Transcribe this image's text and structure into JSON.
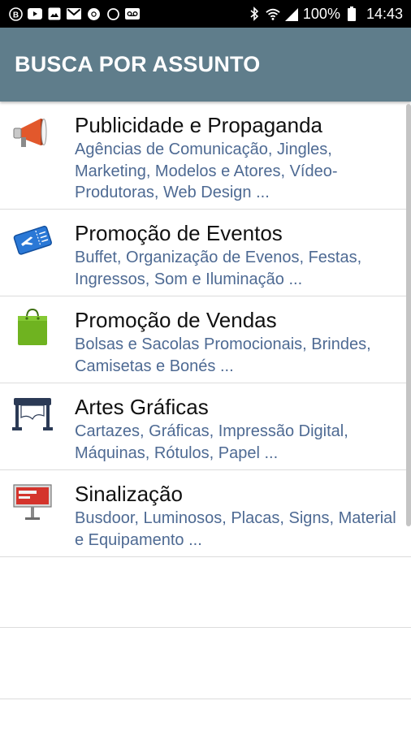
{
  "status_bar": {
    "left_icons": [
      "b-circle-icon",
      "youtube-icon",
      "gallery-icon",
      "gmail-icon",
      "chrome-icon",
      "circle-icon",
      "voicemail-icon"
    ],
    "battery": "100%",
    "time": "14:43"
  },
  "appbar": {
    "title": "BUSCA POR ASSUNTO"
  },
  "categories": [
    {
      "icon": "megaphone-icon",
      "title": "Publicidade e Propaganda",
      "desc": "Agências de Comunicação, Jingles, Marketing, Modelos e Atores, Vídeo-Produtoras, Web Design ..."
    },
    {
      "icon": "ticket-icon",
      "title": "Promoção de Eventos",
      "desc": "Buffet, Organização de Evenos, Festas, Ingressos, Som e Iluminação ..."
    },
    {
      "icon": "shopping-bag-icon",
      "title": "Promoção de Vendas",
      "desc": "Bolsas e Sacolas Promocionais, Brindes, Camisetas e Bonés ..."
    },
    {
      "icon": "printer-icon",
      "title": "Artes Gráficas",
      "desc": "Cartazes, Gráficas, Impressão Digital, Máquinas, Rótulos, Papel ..."
    },
    {
      "icon": "billboard-icon",
      "title": "Sinalização",
      "desc": "Busdoor, Luminosos, Placas, Signs, Material e Equipamento ..."
    }
  ],
  "colors": {
    "appbar": "#5f7d8b",
    "desc_text": "#4e6a93",
    "status_bar": "#000000"
  }
}
